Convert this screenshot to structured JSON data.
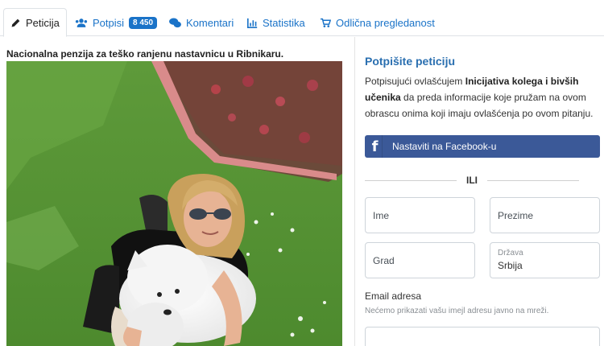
{
  "tabs": [
    {
      "label": "Peticija",
      "icon": "pencil-icon",
      "active": true
    },
    {
      "label": "Potpisi",
      "icon": "users-icon",
      "badge": "8 450"
    },
    {
      "label": "Komentari",
      "icon": "comments-icon"
    },
    {
      "label": "Statistika",
      "icon": "chart-icon"
    },
    {
      "label": "Odlična pregledanost",
      "icon": "cart-icon"
    }
  ],
  "petition": {
    "title": "Nacionalna penzija za teško ranjenu nastavnicu u Ribnikaru."
  },
  "sign": {
    "title": "Potpišite peticiju",
    "consent_pre": "Potpisujući ovlašćujem ",
    "consent_org": "Inicijativa kolega i bivših učenika",
    "consent_post": " da preda informacije koje pružam na ovom obrascu onima koji imaju ovlašćenja po ovom pitanju.",
    "facebook_label": "Nastaviti na Facebook-u",
    "or_label": "ILI",
    "first_name_placeholder": "Ime",
    "last_name_placeholder": "Prezime",
    "city_placeholder": "Grad",
    "country_label": "Država",
    "country_value": "Srbija",
    "email_label": "Email adresa",
    "email_help": "Nećemo prikazati vašu imejl adresu javno na mreži."
  },
  "colors": {
    "accent": "#1a73c8",
    "facebook": "#3b5998",
    "title_blue": "#2a6fb0"
  }
}
